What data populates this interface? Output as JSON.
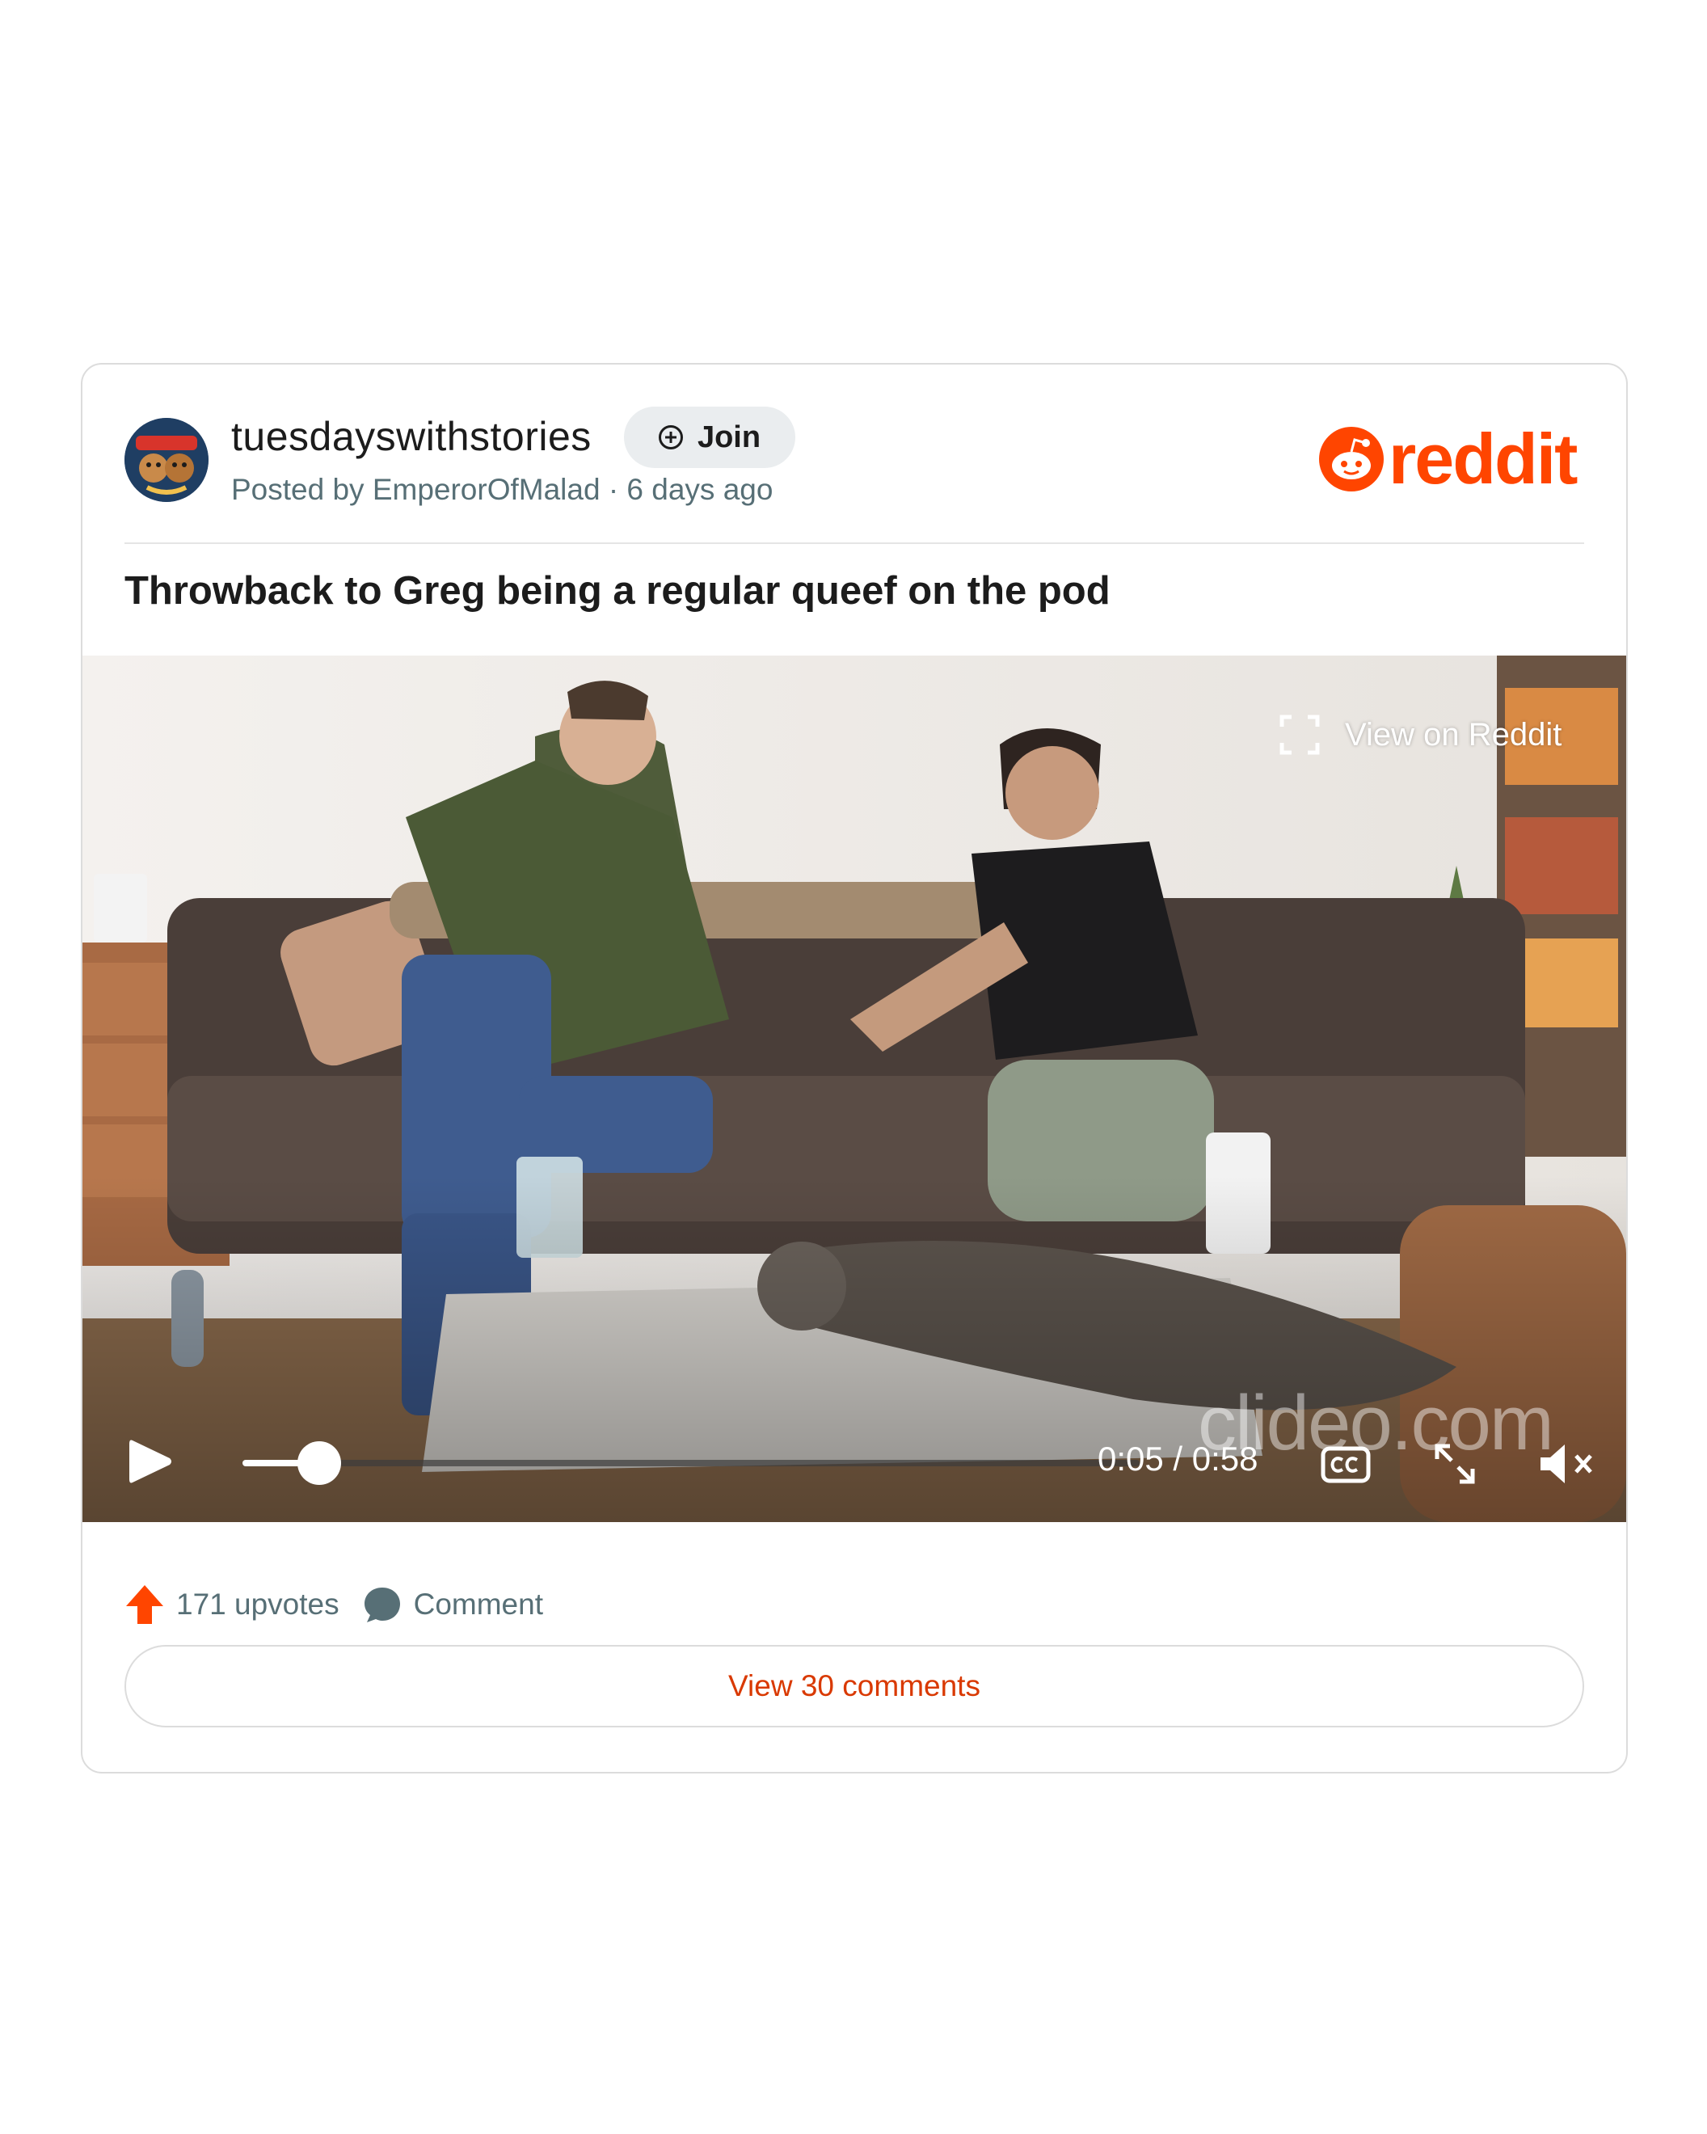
{
  "post": {
    "subreddit": "tuesdayswithstories",
    "join_label": "Join",
    "meta": "Posted by EmperorOfMalad · 6 days ago",
    "title": "Throwback to Greg being a regular queef on the pod",
    "brand": "reddit"
  },
  "video": {
    "view_on_label": "View on Reddit",
    "time": "0:05 / 0:58",
    "progress_fraction": 0.086,
    "watermark": "clideo.com"
  },
  "footer": {
    "upvotes": "171 upvotes",
    "comment_label": "Comment",
    "view_comments": "View 30 comments"
  },
  "colors": {
    "brand": "#ff4500",
    "link": "#d93900",
    "meta": "#576f76"
  }
}
